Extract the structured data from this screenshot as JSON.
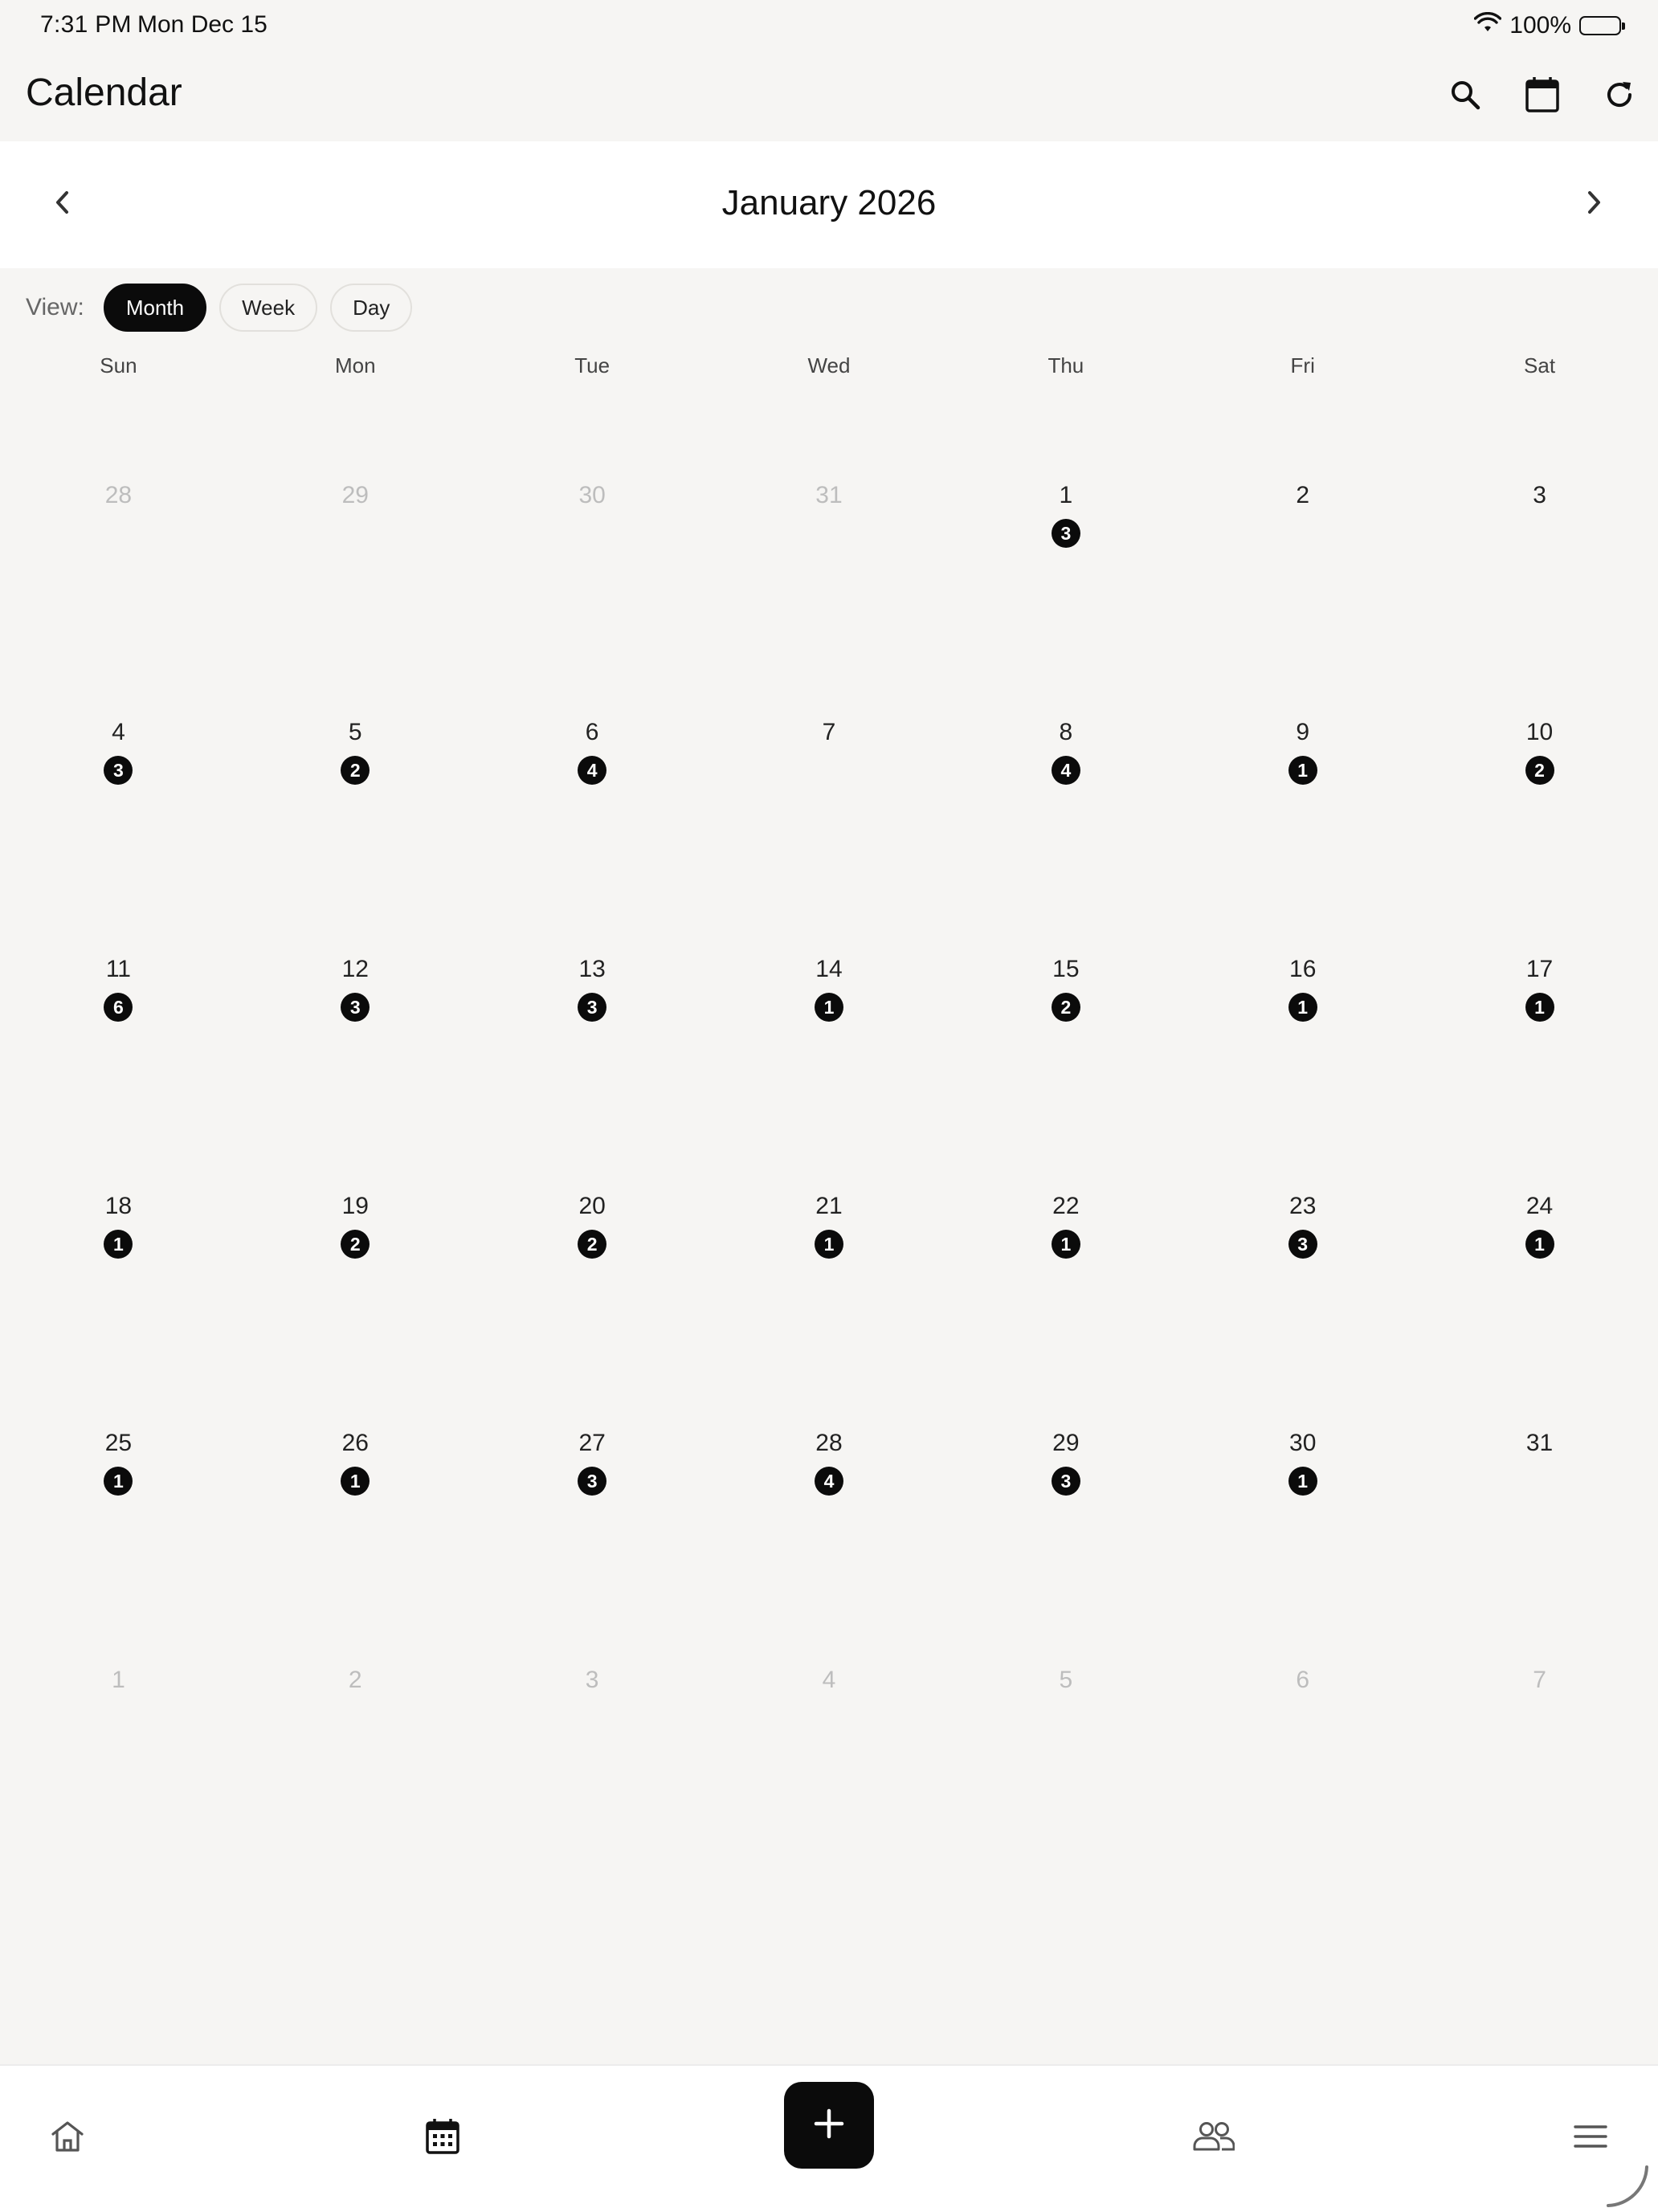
{
  "status_bar": {
    "time": "7:31 PM",
    "date": "Mon Dec 15",
    "battery": "100%"
  },
  "app": {
    "title": "Calendar"
  },
  "toolbar_icons": [
    "search-icon",
    "calendar-icon",
    "refresh-icon"
  ],
  "month_title": "January 2026",
  "view": {
    "label": "View:",
    "options": [
      "Month",
      "Week",
      "Day"
    ],
    "selected": "Month"
  },
  "weekdays": [
    "Sun",
    "Mon",
    "Tue",
    "Wed",
    "Thu",
    "Fri",
    "Sat"
  ],
  "days": [
    {
      "day": "28",
      "count": "",
      "outside": true
    },
    {
      "day": "29",
      "count": "",
      "outside": true
    },
    {
      "day": "30",
      "count": "",
      "outside": true
    },
    {
      "day": "31",
      "count": "",
      "outside": true
    },
    {
      "day": "1",
      "count": "3"
    },
    {
      "day": "2",
      "count": ""
    },
    {
      "day": "3",
      "count": ""
    },
    {
      "day": "4",
      "count": "3"
    },
    {
      "day": "5",
      "count": "2"
    },
    {
      "day": "6",
      "count": "4"
    },
    {
      "day": "7",
      "count": ""
    },
    {
      "day": "8",
      "count": "4"
    },
    {
      "day": "9",
      "count": "1"
    },
    {
      "day": "10",
      "count": "2"
    },
    {
      "day": "11",
      "count": "6"
    },
    {
      "day": "12",
      "count": "3"
    },
    {
      "day": "13",
      "count": "3"
    },
    {
      "day": "14",
      "count": "1"
    },
    {
      "day": "15",
      "count": "2"
    },
    {
      "day": "16",
      "count": "1"
    },
    {
      "day": "17",
      "count": "1"
    },
    {
      "day": "18",
      "count": "1"
    },
    {
      "day": "19",
      "count": "2"
    },
    {
      "day": "20",
      "count": "2"
    },
    {
      "day": "21",
      "count": "1"
    },
    {
      "day": "22",
      "count": "1"
    },
    {
      "day": "23",
      "count": "3"
    },
    {
      "day": "24",
      "count": "1"
    },
    {
      "day": "25",
      "count": "1"
    },
    {
      "day": "26",
      "count": "1"
    },
    {
      "day": "27",
      "count": "3"
    },
    {
      "day": "28",
      "count": "4"
    },
    {
      "day": "29",
      "count": "3"
    },
    {
      "day": "30",
      "count": "1"
    },
    {
      "day": "31",
      "count": ""
    },
    {
      "day": "1",
      "count": "",
      "outside": true
    },
    {
      "day": "2",
      "count": "",
      "outside": true
    },
    {
      "day": "3",
      "count": "",
      "outside": true
    },
    {
      "day": "4",
      "count": "",
      "outside": true
    },
    {
      "day": "5",
      "count": "",
      "outside": true
    },
    {
      "day": "6",
      "count": "",
      "outside": true
    },
    {
      "day": "7",
      "count": "",
      "outside": true
    }
  ],
  "bottom_nav": [
    "home-icon",
    "calendar-icon",
    "add-icon",
    "people-icon",
    "menu-icon"
  ],
  "colors": {
    "background": "#f6f5f3",
    "surface": "#ffffff",
    "accent": "#0b0b0b",
    "muted_day": "#bdbdbd"
  }
}
